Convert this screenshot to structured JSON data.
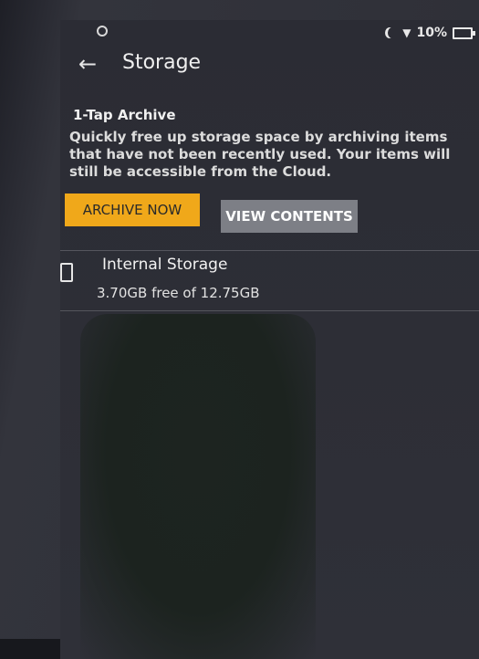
{
  "status_bar": {
    "battery_percent": "10%",
    "icons": [
      "notification-dot-icon",
      "moon-icon",
      "wifi-icon",
      "battery-icon"
    ]
  },
  "toolbar": {
    "back_icon": "arrow-left-icon",
    "title": "Storage"
  },
  "archive": {
    "title": "1-Tap Archive",
    "description": "Quickly free up storage space by archiving items that have not been recently used. Your items will still be accessible from the Cloud.",
    "archive_button": "ARCHIVE NOW",
    "view_button": "VIEW CONTENTS"
  },
  "storage": {
    "icon": "device-icon",
    "title": "Internal Storage",
    "detail": "3.70GB free of 12.75GB"
  },
  "colors": {
    "accent": "#f0a81a",
    "background": "#2d2e36",
    "secondary_button": "#7d7f86"
  }
}
